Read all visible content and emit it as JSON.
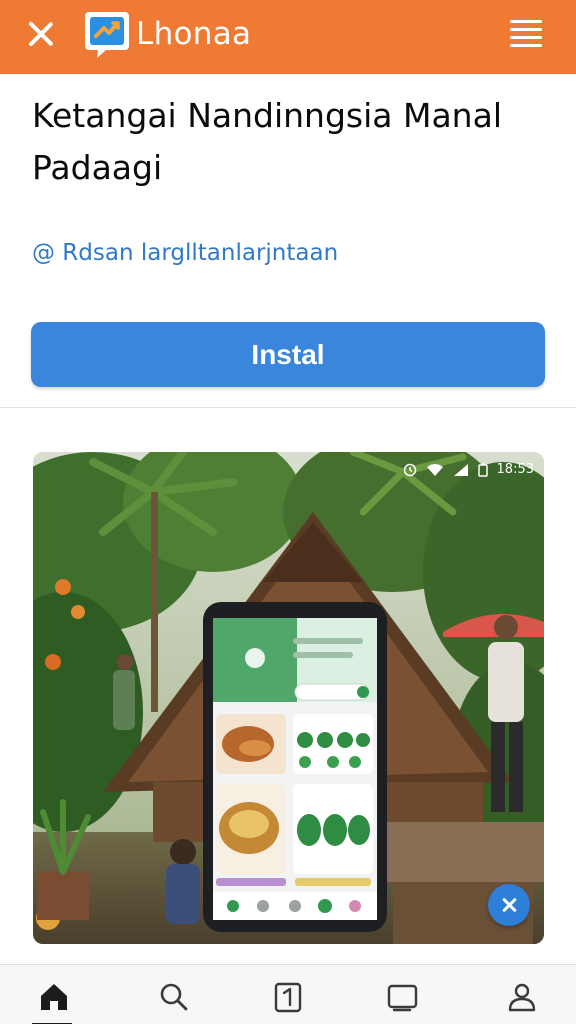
{
  "header": {
    "close_icon": "close-icon",
    "logo_icon": "chat-bubble-logo-icon",
    "brand": "Lhonaa",
    "menu_icon": "menu-icon"
  },
  "app": {
    "title": "Ketangai Nandinngsia Manal Padaagi",
    "developer": "@ Rdsan larglltanlarjntaan",
    "install_label": "Instal"
  },
  "preview": {
    "status_time": "18:53",
    "close_icon": "close-icon"
  },
  "bottom_nav": {
    "items": [
      {
        "icon": "home-icon",
        "active": true
      },
      {
        "icon": "search-icon",
        "active": false
      },
      {
        "icon": "updates-icon",
        "active": false
      },
      {
        "icon": "library-icon",
        "active": false
      },
      {
        "icon": "profile-icon",
        "active": false
      }
    ]
  },
  "colors": {
    "header": "#ee7a34",
    "install_button": "#3a86dd",
    "developer_link": "#2f79c7",
    "fab": "#2e7fd8"
  }
}
